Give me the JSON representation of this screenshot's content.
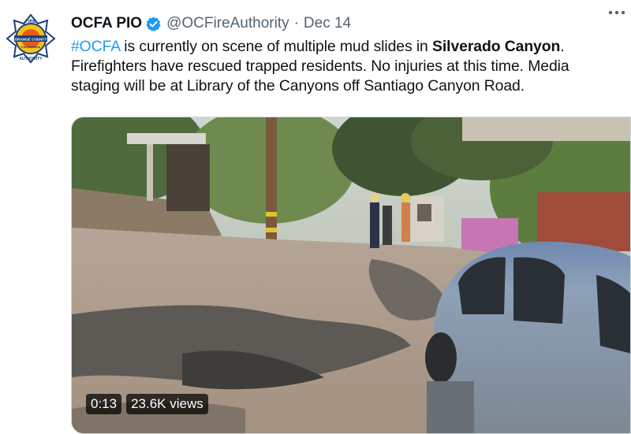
{
  "tweet": {
    "display_name": "OCFA PIO",
    "handle": "@OCFireAuthority",
    "separator": "·",
    "date": "Dec 14",
    "verified": true,
    "text": {
      "line1": {
        "hashtag": "#OCFA",
        "middle": " is currently on scene of multiple mud slides in ",
        "place": "Silverado Canyon",
        "end": "."
      },
      "line2": "Firefighters have rescued trapped residents.  No injuries at this time.  Media",
      "line3": "staging will be at Library of the Canyons off Santiago Canyon Road."
    }
  },
  "avatar": {
    "icon": "ocfa-badge-icon",
    "logo_text_top": "FIRE",
    "logo_text_ribbon": "ORANGE COUNTY",
    "logo_text_state": "CALIFORNIA",
    "logo_text_bottom": "AUTHORITY"
  },
  "media": {
    "duration": "0:13",
    "views": "23.6K views"
  },
  "colors": {
    "link": "#1d9bf0",
    "text": "#0f1419",
    "muted": "#536471",
    "verified": "#1d9bf0"
  }
}
